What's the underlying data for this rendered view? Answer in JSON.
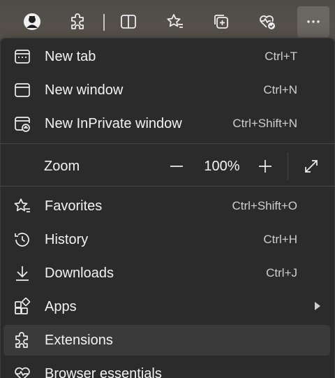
{
  "toolbar": {
    "buttons": [
      {
        "icon": "profile-icon"
      },
      {
        "icon": "extensions-puzzle-icon"
      },
      {
        "icon": "split-screen-icon"
      },
      {
        "icon": "favorites-star-icon"
      },
      {
        "icon": "collections-icon"
      },
      {
        "icon": "browser-essentials-heart-icon"
      },
      {
        "icon": "more-ellipsis-icon"
      }
    ]
  },
  "menu": {
    "new_tab": {
      "label": "New tab",
      "shortcut": "Ctrl+T",
      "icon": "new-tab-icon"
    },
    "new_window": {
      "label": "New window",
      "shortcut": "Ctrl+N",
      "icon": "new-window-icon"
    },
    "new_inprivate": {
      "label": "New InPrivate window",
      "shortcut": "Ctrl+Shift+N",
      "icon": "inprivate-window-icon"
    },
    "zoom": {
      "label": "Zoom",
      "value": "100%"
    },
    "favorites": {
      "label": "Favorites",
      "shortcut": "Ctrl+Shift+O",
      "icon": "favorites-icon"
    },
    "history": {
      "label": "History",
      "shortcut": "Ctrl+H",
      "icon": "history-icon"
    },
    "downloads": {
      "label": "Downloads",
      "shortcut": "Ctrl+J",
      "icon": "downloads-icon"
    },
    "apps": {
      "label": "Apps",
      "icon": "apps-icon"
    },
    "extensions": {
      "label": "Extensions",
      "icon": "extensions-icon"
    },
    "browser_essentials": {
      "label": "Browser essentials",
      "icon": "browser-essentials-icon"
    }
  },
  "colors": {
    "menu_bg": "#2b2b2b",
    "hover_bg": "#3a3a3a",
    "text": "#f3f3f3",
    "shortcut_text": "#cfcfcf"
  }
}
